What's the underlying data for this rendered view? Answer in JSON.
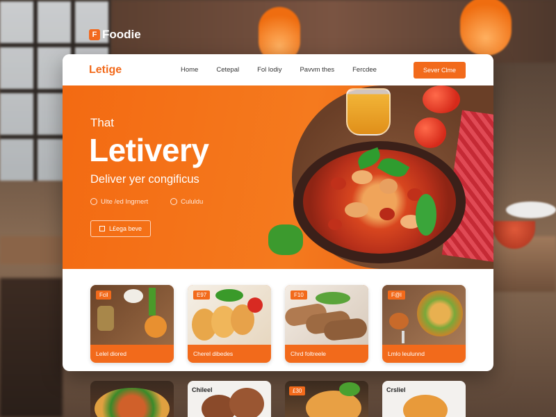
{
  "brand": {
    "name": "Foodie",
    "logo_glyph": "F"
  },
  "nav": {
    "logo": "Letige",
    "links": [
      "Home",
      "Cetepal",
      "Fol lodiy",
      "Pavvm thes",
      "Fercdee"
    ],
    "cta": "Sever Clme"
  },
  "hero": {
    "eyebrow": "That",
    "headline": "Letivery",
    "subtitle": "Deliver yer congificus",
    "meta": [
      "Ulte /ed Ingrnert",
      "Cululdu"
    ],
    "button": "L£ega beve"
  },
  "food_cards": [
    {
      "tag": "Fcil",
      "label": "Lelel diored"
    },
    {
      "tag": "E97",
      "label": "Cherel dibedes"
    },
    {
      "tag": "F10",
      "label": "Chrd foltreele"
    },
    {
      "tag": "F@l",
      "label": "Lmlo leulunnd"
    }
  ],
  "second_row": [
    {
      "tag": ""
    },
    {
      "tag": "Chileel"
    },
    {
      "tag": "£30"
    },
    {
      "tag": "Crsliel"
    }
  ],
  "colors": {
    "accent": "#f26a1b",
    "hero": "#f57a1e"
  }
}
